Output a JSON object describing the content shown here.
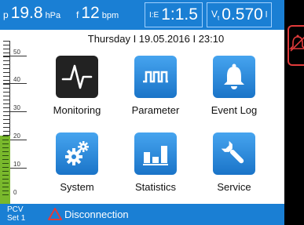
{
  "topbar": {
    "pressure": {
      "symbol": "p",
      "value": "19.8",
      "unit": "hPa"
    },
    "frequency": {
      "symbol": "f",
      "value": "12",
      "unit": "bpm"
    },
    "ie_ratio": {
      "symbol": "I:E",
      "value": "1:1.5"
    },
    "tidal_volume": {
      "symbol": "V",
      "subscript": "t",
      "value": "0.570",
      "unit": "l"
    }
  },
  "datetime": "Thursday I 19.05.2016 I 23:10",
  "scale": {
    "labels": [
      "50",
      "40",
      "30",
      "20",
      "10",
      "0"
    ],
    "level": 20
  },
  "tiles": [
    {
      "label": "Monitoring",
      "icon": "waveform-icon",
      "selected": true
    },
    {
      "label": "Parameter",
      "icon": "pulse-train-icon",
      "selected": false
    },
    {
      "label": "Event Log",
      "icon": "bell-icon",
      "selected": false
    },
    {
      "label": "System",
      "icon": "gears-icon",
      "selected": false
    },
    {
      "label": "Statistics",
      "icon": "bar-chart-icon",
      "selected": false
    },
    {
      "label": "Service",
      "icon": "wrench-icon",
      "selected": false
    }
  ],
  "bottombar": {
    "mode_line1": "PCV",
    "mode_line2": "Set 1",
    "alarm_text": "Disconnection"
  },
  "colors": {
    "accent": "#1a7fd4",
    "alarm": "#e23b3b",
    "level": "#79b82c"
  }
}
